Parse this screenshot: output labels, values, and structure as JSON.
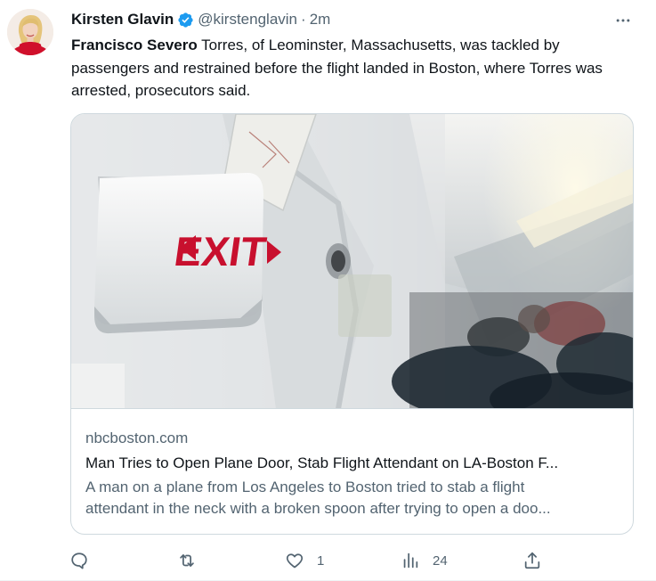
{
  "tweet": {
    "author": {
      "display_name": "Kirsten Glavin",
      "handle": "@kirstenglavin",
      "verified": true,
      "avatar_icon": "profile-photo"
    },
    "separator": "·",
    "time": "2m",
    "more_icon": "more-horizontal-icon",
    "text_bold": "Francisco Severo",
    "text_rest": " Torres, of Leominster, Massachusetts, was tackled by passengers and restrained before the flight landed in Boston, where Torres was arrested, prosecutors said.",
    "card": {
      "image_icon": "airplane-exit-sign-photo",
      "image_exit_text": "EXIT",
      "domain": "nbcboston.com",
      "title": "Man Tries to Open Plane Door, Stab Flight Attendant on LA-Boston F...",
      "description_line1": "A man on a plane from Los Angeles to Boston tried to stab a flight",
      "description_line2": "attendant in the neck with a broken spoon after trying to open a doo..."
    },
    "actions": {
      "reply": {
        "icon": "reply-icon",
        "count": ""
      },
      "retweet": {
        "icon": "retweet-icon",
        "count": ""
      },
      "like": {
        "icon": "heart-icon",
        "count": "1"
      },
      "views": {
        "icon": "views-bar-chart-icon",
        "count": "24"
      },
      "share": {
        "icon": "share-icon",
        "count": ""
      }
    }
  },
  "colors": {
    "text_primary": "#0f1419",
    "text_secondary": "#536471",
    "border": "#cfd9de",
    "verified": "#1d9bf0",
    "exit_red": "#c8102e"
  }
}
